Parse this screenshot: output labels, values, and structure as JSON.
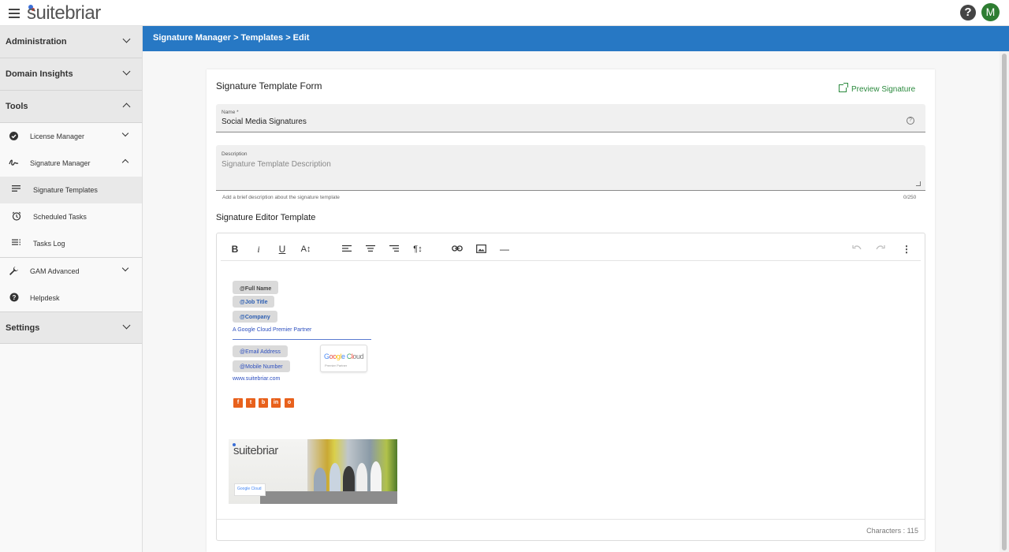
{
  "app": {
    "logo": "suitebriar",
    "help_icon": "?",
    "avatar_initial": "M",
    "avatar_color": "#2e7d32",
    "accent": "#2778c4"
  },
  "sidebar": {
    "sections": [
      {
        "label": "Administration",
        "expanded": false
      },
      {
        "label": "Domain Insights",
        "expanded": false
      },
      {
        "label": "Tools",
        "expanded": true
      },
      {
        "label": "Settings",
        "expanded": false
      }
    ],
    "tools": {
      "license_manager": "License Manager",
      "signature_manager": "Signature Manager",
      "signature_templates": "Signature Templates",
      "scheduled_tasks": "Scheduled Tasks",
      "tasks_log": "Tasks Log",
      "gam_advanced": "GAM Advanced",
      "helpdesk": "Helpdesk"
    }
  },
  "breadcrumb": "Signature Manager > Templates > Edit",
  "form": {
    "title": "Signature Template Form",
    "preview_label": "Preview Signature",
    "name_label": "Name *",
    "name_value": "Social Media Signatures",
    "name_help_icon": "?",
    "description_label": "Description",
    "description_placeholder": "Signature Template Description",
    "description_hint": "Add a brief description about the signature template",
    "description_count": "0/250",
    "editor_title": "Signature Editor Template"
  },
  "editor": {
    "toolbar": {
      "bold": "B",
      "italic": "i",
      "underline": "U",
      "font_size": "A↕",
      "paragraph": "¶↕",
      "divider": "—",
      "more": "⋮"
    },
    "signature": {
      "full_name": "@Full Name",
      "job_title": "@Job Title",
      "company": "@Company",
      "partner_line": "A Google Cloud Premier Partner",
      "email": "@Email Address",
      "mobile": "@Mobile Number",
      "website": "www.suitebriar.com",
      "badge_title": "Google Cloud",
      "badge_sub": "Premier Partner",
      "social": [
        "f",
        "t",
        "b",
        "in",
        "o"
      ],
      "social_color": "#e8611c",
      "banner_logo": "suitebriar",
      "banner_badge": "Google Cloud"
    },
    "char_count": "Characters : 115"
  }
}
